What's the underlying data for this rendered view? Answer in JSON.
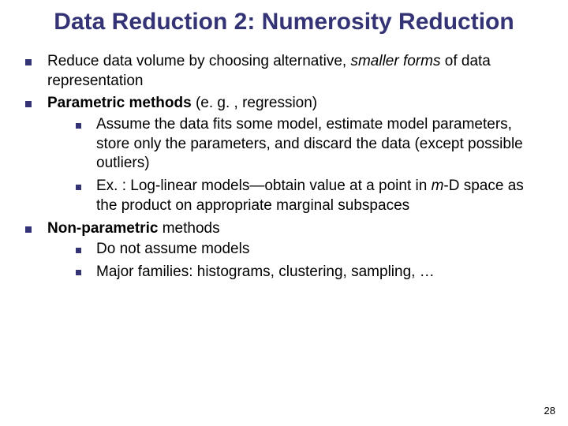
{
  "title": "Data Reduction 2: Numerosity Reduction",
  "b1": {
    "pre": "Reduce data volume by choosing alternative, ",
    "it": "smaller forms",
    "post": " of data representation"
  },
  "b2": {
    "bold": "Parametric methods",
    "rest": " (e. g. , regression)",
    "s1": "Assume the data fits some model, estimate model parameters, store only the parameters, and discard the data (except possible outliers)",
    "s2": {
      "pre": "Ex. : Log-linear models—obtain value at a point in ",
      "it": "m",
      "post": "-D space as the product on appropriate marginal subspaces"
    }
  },
  "b3": {
    "bold": "Non-parametric",
    "rest": " methods",
    "s1": "Do not assume models",
    "s2": "Major families: histograms, clustering, sampling, …"
  },
  "page": "28"
}
